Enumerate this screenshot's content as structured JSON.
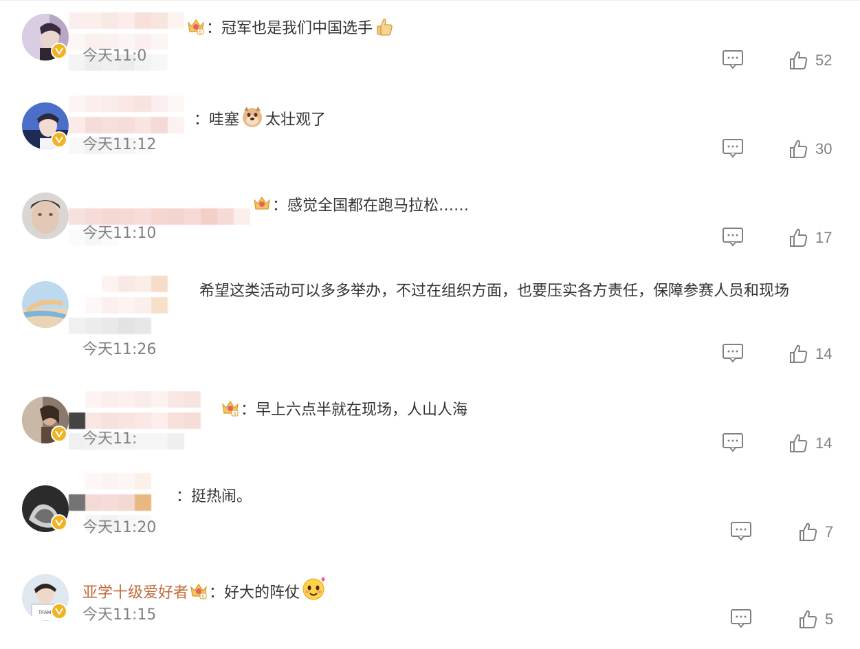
{
  "comments": [
    {
      "username": "",
      "crown_level": "6",
      "text": "：冠军也是我们中国选手",
      "emoji": "thumbs-up",
      "time": "今天11:0",
      "likes": "52",
      "verified": true
    },
    {
      "username": "",
      "crown_level": "7",
      "text_before": "：哇塞",
      "emoji": "doge",
      "text_after": "太壮观了",
      "time": "今天11:12",
      "likes": "30",
      "verified": true
    },
    {
      "username": "",
      "crown_level": "",
      "text": "：感觉全国都在跑马拉松……",
      "time": "今天11:10",
      "likes": "17",
      "verified": false
    },
    {
      "username": "",
      "text_line1": "希望这类活动可以多多举办，不过在组织方面，也要压实各方责任，保障参赛人员和现场",
      "time": "今天11:26",
      "likes": "14",
      "verified": false
    },
    {
      "username": "",
      "crown_level": "6",
      "text": "：早上六点半就在现场，人山人海",
      "time": "今天11:",
      "likes": "14",
      "verified": true
    },
    {
      "username": "",
      "text": "：挺热闹。",
      "time": "今天11:20",
      "likes": "7",
      "verified": true
    },
    {
      "username": "亚学十级爱好者",
      "crown_level": "5",
      "text": "：好大的阵仗",
      "emoji": "blush",
      "time": "今天11:15",
      "likes": "5",
      "verified": true
    }
  ],
  "icons": {
    "reply": "comment-bubble-icon",
    "like": "thumbs-up-outline-icon",
    "verified": "verified-v-icon",
    "crown": "crown-badge-icon"
  },
  "colors": {
    "username": "#c16a3e",
    "text": "#333333",
    "meta": "#808080",
    "verified": "#f0b323"
  }
}
